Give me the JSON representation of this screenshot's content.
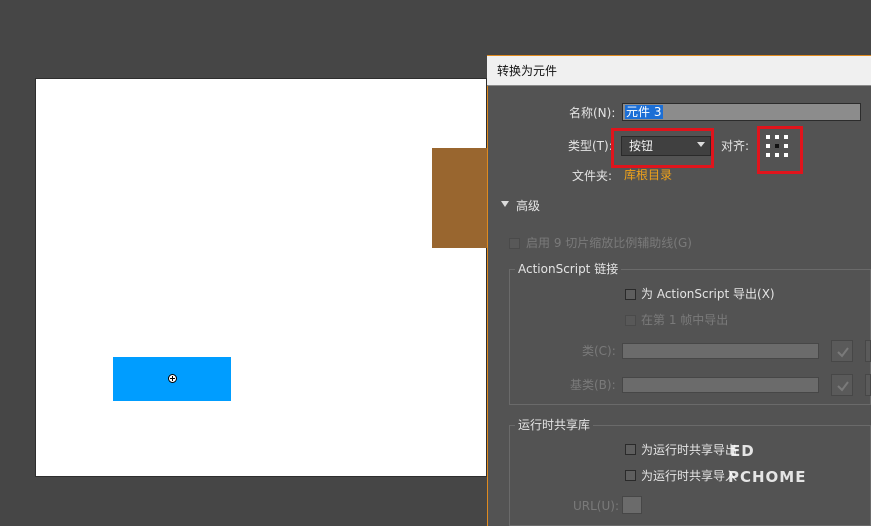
{
  "stage": {
    "bg": "#ffffff"
  },
  "shapes": {
    "brown": "#99662f",
    "blue": "#009dff"
  },
  "dialog": {
    "title": "转换为元件",
    "name_label": "名称(N):",
    "name_value": "元件 3",
    "type_label": "类型(T):",
    "type_value": "按钮",
    "align_label": "对齐:",
    "folder_label": "文件夹:",
    "folder_value": "库根目录",
    "advanced_label": "高级",
    "enable_9slice_label": "启用 9 切片缩放比例辅助线(G)",
    "actionscript": {
      "group_title": "ActionScript 链接",
      "export_for_as_label": "为 ActionScript 导出(X)",
      "export_in_frame_label": "在第 1 帧中导出",
      "class_label": "类(C):",
      "base_class_label": "基类(B):"
    },
    "runtime": {
      "group_title": "运行时共享库",
      "export_runtime_label": "为运行时共享导出",
      "import_runtime_label": "为运行时共享导入",
      "url_label": "URL(U):"
    }
  },
  "watermark": {
    "line1": "ED",
    "line2": "PCHOME"
  },
  "colors": {
    "highlight": "#e0141c",
    "accent_link": "#f0a21a",
    "selection": "#1c6fd6"
  }
}
